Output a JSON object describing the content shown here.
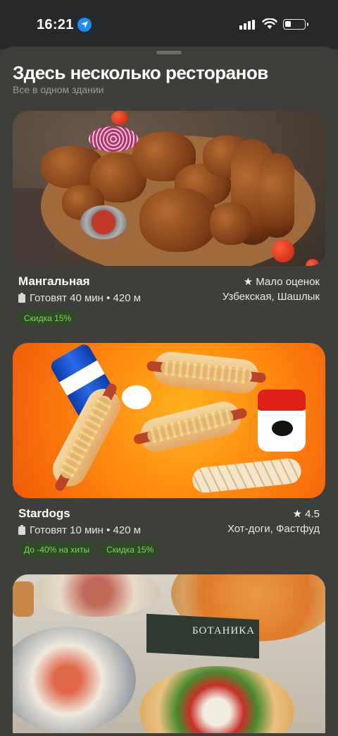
{
  "status_bar": {
    "time": "16:21"
  },
  "sheet": {
    "title": "Здесь несколько ресторанов",
    "subtitle": "Все в одном здании"
  },
  "restaurants": [
    {
      "name": "Мангальная",
      "rating": "★ Мало оценок",
      "meta": "Готовят 40 мин • 420 м",
      "cuisine": "Узбекская, Шашлык",
      "badges": [
        "Скидка 15%"
      ]
    },
    {
      "name": "Stardogs",
      "rating": "★ 4.5",
      "meta": "Готовят 10 мин • 420 м",
      "cuisine": "Хот-доги, Фастфуд",
      "badges": [
        "До -40% на хиты",
        "Скидка 15%"
      ]
    },
    {
      "photo_sign": "БОТАНИКА"
    }
  ],
  "colors": {
    "background": "#3b3b37",
    "badge_text": "#7ed85a",
    "badge_bg": "#2f4a26",
    "location_blue": "#1c8cf5"
  }
}
